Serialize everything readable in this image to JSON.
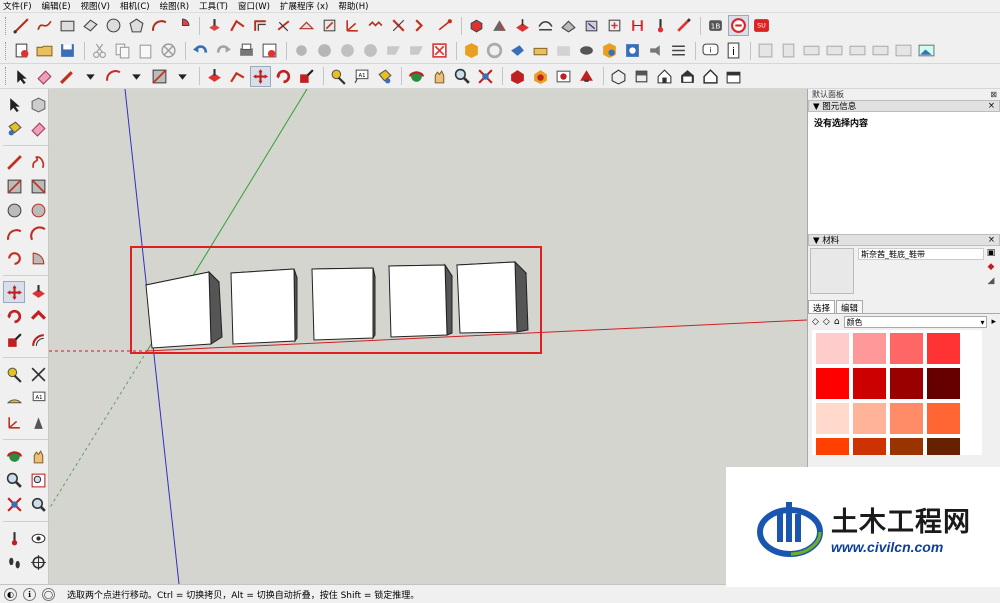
{
  "menu": [
    "文件(F)",
    "编辑(E)",
    "视图(V)",
    "相机(C)",
    "绘图(R)",
    "工具(T)",
    "窗口(W)",
    "扩展程序 (x)",
    "帮助(H)"
  ],
  "colors": {
    "selection_box": "#e02020",
    "red_axis": "#d02020",
    "green_axis": "#20a020",
    "blue_axis": "#2020c0",
    "viewport_bg": "#d5d5d0"
  },
  "toolbar_row1_icons": [
    "line-tool-icon",
    "freehand-icon",
    "rectangle-icon",
    "rotated-rectangle-icon",
    "circle-icon",
    "polygon-icon",
    "arc-icon",
    "pie-icon",
    "push-pull-icon",
    "follow-me-icon",
    "offset-icon",
    "text-icon",
    "dimension-icon",
    "protractor-icon",
    "axes-icon",
    "3d-text-icon",
    "section-plane-icon",
    "walk-icon",
    "look-around-icon",
    "paint-bucket-icon",
    "eraser-icon",
    "tape-measure-icon",
    "extension-1b-icon",
    "extension-su-app-icon"
  ],
  "toolbar_row2_icons": [
    "new-file-icon",
    "open-file-icon",
    "save-icon",
    "cut-icon",
    "copy-icon",
    "paste-icon",
    "erase-icon",
    "undo-icon",
    "redo-icon",
    "print-icon",
    "model-info-icon",
    "orbit-icon",
    "pan-icon",
    "zoom-icon",
    "zoom-window-icon",
    "zoom-extents-icon",
    "previous-view-icon",
    "component-icon",
    "group-icon",
    "outliner-icon",
    "layers-icon",
    "materials-icon",
    "styles-icon",
    "scenes-icon",
    "shadows-icon",
    "fog-icon",
    "section-cut-icon",
    "help-icon",
    "info-icon",
    "iso-view-icon",
    "top-view-icon",
    "front-view-icon",
    "right-view-icon",
    "back-view-icon",
    "left-view-icon"
  ],
  "toolbar_row3_icons": [
    "select-icon",
    "eraser-icon",
    "pencil-icon",
    "arc-icon",
    "shape-icon",
    "push-pull-icon",
    "rotate-icon",
    "move-icon",
    "rotate-icon",
    "scale-icon",
    "tape-measure-icon",
    "text-icon",
    "paint-bucket-icon",
    "orbit-icon",
    "pan-icon",
    "zoom-icon",
    "zoom-extents-icon",
    "warehouse-icon",
    "extension-warehouse-icon",
    "model-upload-icon",
    "3d-warehouse-icon",
    "iso-icon",
    "top-icon",
    "front-icon",
    "right-icon",
    "back-icon",
    "left-icon"
  ],
  "right_panel": {
    "tray_title": "默认面板",
    "entity_info_title": "图元信息",
    "entity_info_content": "没有选择内容",
    "materials_title": "材料",
    "material_name": "斯奈茜_鞋底_鞋带",
    "tabs": [
      "选择",
      "编辑"
    ],
    "category": "颜色",
    "swatches": [
      "#ffcccc",
      "#ff9999",
      "#ff6666",
      "#ff3333",
      "#ff0000",
      "#cc0000",
      "#990000",
      "#660000",
      "#ffd9cc",
      "#ffb399",
      "#ff8c66",
      "#ff6633",
      "#ff4000",
      "#cc3300",
      "#993300",
      "#662200"
    ]
  },
  "status": {
    "text": "选取两个点进行移动。Ctrl = 切换拷贝，Alt = 切换自动折叠，按住 Shift = 锁定推理。"
  },
  "watermark": {
    "title": "土木工程网",
    "url": "www.civilcn.com"
  }
}
